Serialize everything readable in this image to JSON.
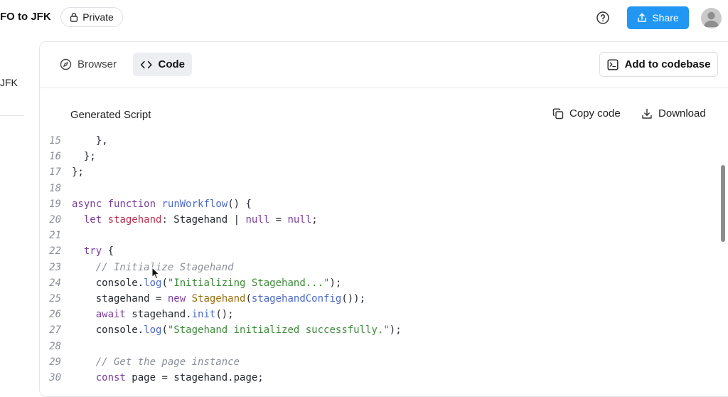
{
  "header": {
    "title": "FO to JFK",
    "private_label": "Private",
    "share_label": "Share"
  },
  "sidebar": {
    "item_label": "JFK"
  },
  "panel": {
    "tabs": [
      {
        "label": "Browser",
        "icon": "compass-icon"
      },
      {
        "label": "Code",
        "icon": "code-brackets-icon",
        "active": true
      }
    ],
    "add_to_codebase_label": "Add to codebase",
    "script_title": "Generated Script",
    "copy_label": "Copy code",
    "download_label": "Download"
  },
  "code": {
    "lines": [
      {
        "n": "15",
        "text": "    },"
      },
      {
        "n": "16",
        "text": "  };"
      },
      {
        "n": "17",
        "text": "};"
      },
      {
        "n": "18",
        "text": ""
      },
      {
        "n": "19",
        "text": "async function runWorkflow() {"
      },
      {
        "n": "20",
        "text": "  let stagehand: Stagehand | null = null;"
      },
      {
        "n": "21",
        "text": ""
      },
      {
        "n": "22",
        "text": "  try {"
      },
      {
        "n": "23",
        "text": "    // Initialize Stagehand"
      },
      {
        "n": "24",
        "text": "    console.log(\"Initializing Stagehand...\");"
      },
      {
        "n": "25",
        "text": "    stagehand = new Stagehand(stagehandConfig());"
      },
      {
        "n": "26",
        "text": "    await stagehand.init();"
      },
      {
        "n": "27",
        "text": "    console.log(\"Stagehand initialized successfully.\");"
      },
      {
        "n": "28",
        "text": ""
      },
      {
        "n": "29",
        "text": "    // Get the page instance"
      },
      {
        "n": "30",
        "text": "    const page = stagehand.page;"
      }
    ]
  },
  "colors": {
    "accent": "#2196f3",
    "keyword": "#7a3e9d",
    "function": "#4b69c6",
    "string": "#3f8a3b",
    "comment": "#8a8f98"
  }
}
